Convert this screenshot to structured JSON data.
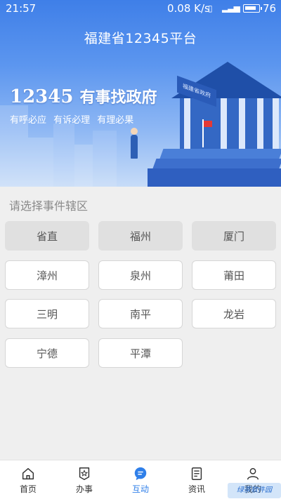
{
  "status_bar": {
    "time": "21:57",
    "net_speed": "0.08 K/s",
    "battery": "76"
  },
  "banner": {
    "platform_title": "福建省12345平台",
    "slogan_number": "12345",
    "slogan_text": "有事找政府",
    "subslogan": "有呼必应  有诉必理  有理必果",
    "building_sign": "福建省政府"
  },
  "region": {
    "prompt": "请选择事件辖区",
    "items": [
      {
        "label": "省直",
        "selected": true
      },
      {
        "label": "福州",
        "selected": true
      },
      {
        "label": "厦门",
        "selected": true
      },
      {
        "label": "漳州",
        "selected": false
      },
      {
        "label": "泉州",
        "selected": false
      },
      {
        "label": "莆田",
        "selected": false
      },
      {
        "label": "三明",
        "selected": false
      },
      {
        "label": "南平",
        "selected": false
      },
      {
        "label": "龙岩",
        "selected": false
      },
      {
        "label": "宁德",
        "selected": false
      },
      {
        "label": "平潭",
        "selected": false
      }
    ]
  },
  "bottom_nav": {
    "active": "互动",
    "active_color": "#2f7fe9",
    "items": [
      {
        "label": "首页",
        "icon": "home-icon"
      },
      {
        "label": "办事",
        "icon": "star-badge-icon"
      },
      {
        "label": "互动",
        "icon": "chat-icon"
      },
      {
        "label": "资讯",
        "icon": "document-list-icon"
      },
      {
        "label": "我的",
        "icon": "user-icon"
      }
    ]
  },
  "watermark": "绿茶软件园"
}
